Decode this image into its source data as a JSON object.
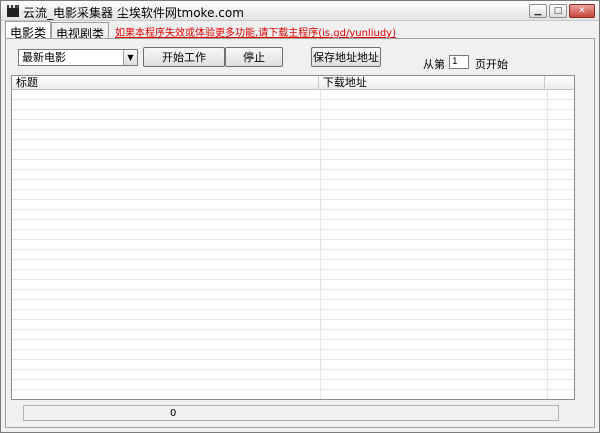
{
  "window": {
    "title": "云流_电影采集器  尘埃软件网tmoke.com",
    "min_label": "▁",
    "max_label": "□",
    "close_label": "✕"
  },
  "tabs": [
    {
      "label": "电影类",
      "active": true
    },
    {
      "label": "电视剧类",
      "active": false
    }
  ],
  "notice_link": "如果本程序失效或体验更多功能,请下载主程序(is.gd/yunliudy)",
  "controls": {
    "category_select": "最新电影",
    "start_button": "开始工作",
    "stop_button": "停止",
    "save_button": "保存地址地址",
    "from_label": "从第",
    "page_input": "1",
    "page_suffix": "页开始"
  },
  "list": {
    "columns": [
      "标题",
      "下载地址",
      ""
    ]
  },
  "status": {
    "count": "0"
  },
  "colors": {
    "link": "#e00000",
    "window_bg": "#f0f0f0"
  }
}
